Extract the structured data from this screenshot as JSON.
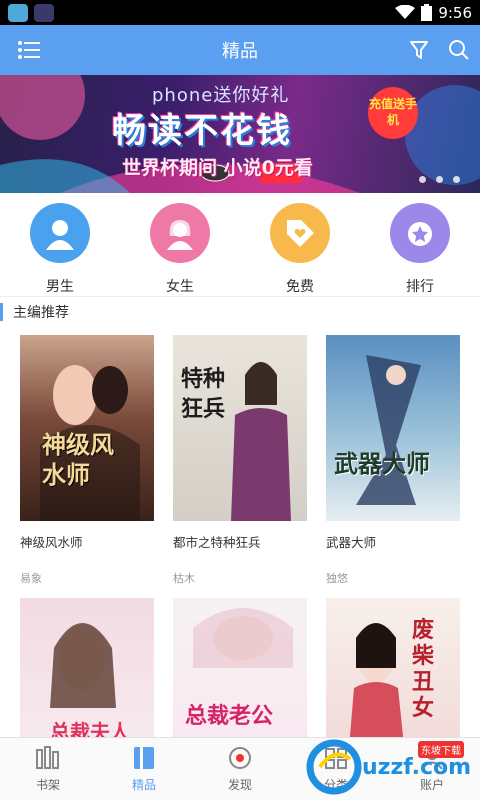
{
  "status": {
    "time": "9:56"
  },
  "header": {
    "title": "精品"
  },
  "banner": {
    "small_text": "phone送你好礼",
    "main_text": "畅读不花钱",
    "sub_text": "世界杯期间 小说0元看",
    "tag_text": "充值送手机"
  },
  "categories": [
    {
      "label": "男生",
      "color": "#4aa2ee"
    },
    {
      "label": "女生",
      "color": "#ef79a6"
    },
    {
      "label": "免费",
      "color": "#f7b94c"
    },
    {
      "label": "排行",
      "color": "#9c88e8"
    }
  ],
  "section": {
    "title": "主编推荐"
  },
  "books": [
    {
      "title": "神级风水师",
      "author": "易象",
      "cover_text": "神级风水师"
    },
    {
      "title": "都市之特种狂兵",
      "author": "枯木",
      "cover_text": "特种狂兵"
    },
    {
      "title": "武器大师",
      "author": "独悠",
      "cover_text": "武器大师"
    },
    {
      "title": "",
      "author": "",
      "cover_text": "总裁夫人"
    },
    {
      "title": "",
      "author": "",
      "cover_text": "总裁老公"
    },
    {
      "title": "",
      "author": "",
      "cover_text": "废柴丑女"
    }
  ],
  "tabs": [
    {
      "label": "书架"
    },
    {
      "label": "精品"
    },
    {
      "label": "发现"
    },
    {
      "label": "分类"
    },
    {
      "label": "账户"
    }
  ],
  "watermark": {
    "text": "uzzf.com",
    "sub": "东坡下载"
  }
}
